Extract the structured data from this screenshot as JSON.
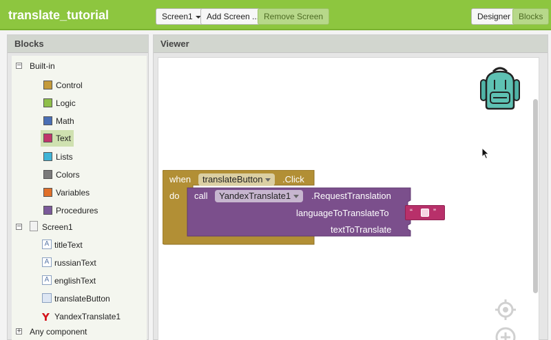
{
  "app": {
    "title": "translate_tutorial"
  },
  "toolbar": {
    "screen_select": "Screen1",
    "add_screen": "Add Screen ...",
    "remove_screen": "Remove Screen",
    "designer": "Designer",
    "blocks": "Blocks"
  },
  "blocks_panel": {
    "header": "Blocks",
    "builtin": {
      "label": "Built-in",
      "items": [
        {
          "label": "Control",
          "color": "#c49a3a"
        },
        {
          "label": "Logic",
          "color": "#8fbf4a"
        },
        {
          "label": "Math",
          "color": "#4a6fb5"
        },
        {
          "label": "Text",
          "color": "#c0356b"
        },
        {
          "label": "Lists",
          "color": "#3fb4d6"
        },
        {
          "label": "Colors",
          "color": "#7a7a7a"
        },
        {
          "label": "Variables",
          "color": "#e0702a"
        },
        {
          "label": "Procedures",
          "color": "#7b5a9a"
        }
      ]
    },
    "screen": {
      "label": "Screen1",
      "components": [
        "titleText",
        "russianText",
        "englishText",
        "translateButton",
        "YandexTranslate1"
      ]
    },
    "any_component": "Any component"
  },
  "viewer": {
    "header": "Viewer",
    "event_block": {
      "when": "when",
      "component": "translateButton",
      "event": ".Click",
      "do": "do"
    },
    "call_block": {
      "call": "call",
      "component": "YandexTranslate1",
      "method": ".RequestTranslation",
      "arg1": "languageToTranslateTo",
      "arg2": "textToTranslate"
    },
    "text_block": {
      "open_quote": "“",
      "close_quote": "”"
    }
  },
  "colors": {
    "brand_green": "#8dc63f",
    "control_block": "#b28f35",
    "component_block": "#7b4f8c",
    "text_block": "#b8306a"
  }
}
